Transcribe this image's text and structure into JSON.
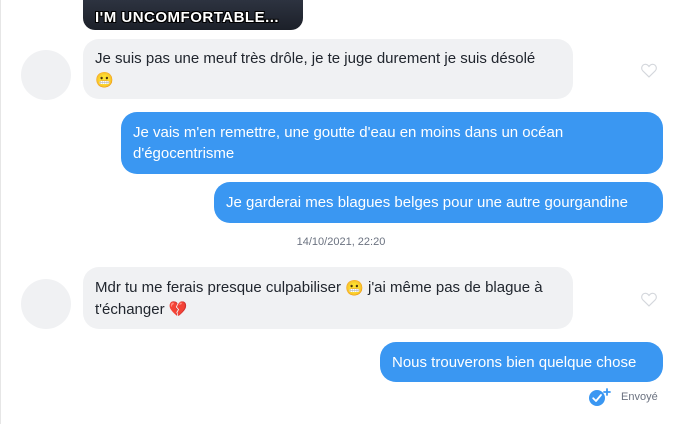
{
  "gif": {
    "caption": "I'M UNCOMFORTABLE..."
  },
  "messages": [
    {
      "id": "m1",
      "direction": "received",
      "text": "Je suis pas une meuf très drôle, je te juge durement je suis désolé",
      "emoji": "😬"
    },
    {
      "id": "m2",
      "direction": "sent",
      "text": "Je vais m'en remettre, une goutte d'eau en moins dans un océan d'égocentrisme"
    },
    {
      "id": "m3",
      "direction": "sent",
      "text": "Je garderai mes blagues belges pour une autre gourgandine"
    },
    {
      "id": "m4",
      "direction": "received",
      "text_before": "Mdr tu me ferais presque culpabiliser",
      "emoji_mid": "😬",
      "text_after": "j'ai même pas de blague à t'échanger",
      "emoji_end": "💔"
    },
    {
      "id": "m5",
      "direction": "sent",
      "text": "Nous trouverons bien quelque chose"
    }
  ],
  "timestamp": "14/10/2021, 22:20",
  "status": {
    "label": "Envoyé",
    "icon": "sent-check-icon"
  },
  "colors": {
    "sent_bubble": "#3a97f2",
    "received_bubble": "#f0f1f3",
    "text_dark": "#21262e"
  }
}
